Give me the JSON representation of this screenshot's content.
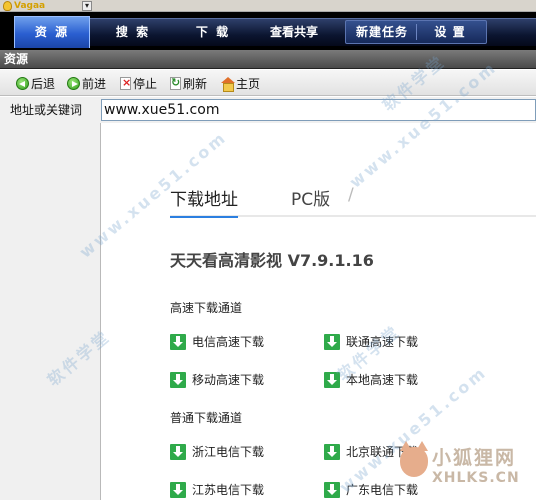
{
  "app": {
    "logo_text": "Vagaa",
    "title_control": "▾"
  },
  "nav": {
    "tabs": [
      {
        "label": "资 源",
        "active": true
      },
      {
        "label": "搜 索"
      },
      {
        "label": "下 载"
      },
      {
        "label": "查看共享"
      }
    ],
    "group": [
      "新建任务",
      "设 置"
    ]
  },
  "section": {
    "title": "资源"
  },
  "toolbar": {
    "back": "后退",
    "forward": "前进",
    "stop": "停止",
    "refresh": "刷新",
    "home": "主页"
  },
  "address": {
    "label": "地址或关键词",
    "value": "www.xue51.com"
  },
  "page": {
    "tabs": [
      "下载地址",
      "PC版"
    ],
    "tab_separator": "/",
    "software_title": "天天看高清影视 V7.9.1.16",
    "groups": [
      {
        "title": "高速下载通道",
        "links": [
          "电信高速下载",
          "联通高速下载",
          "移动高速下载",
          "本地高速下载"
        ]
      },
      {
        "title": "普通下载通道",
        "links": [
          "浙江电信下载",
          "北京联通下载",
          "江苏电信下载",
          "广东电信下载"
        ]
      }
    ]
  },
  "watermarks": {
    "site": "www.xue51.com",
    "cn": "软件学堂",
    "fox_cn": "小狐狸网",
    "fox_en": "XHLKS.CN"
  },
  "colors": {
    "accent_tab": "#2b7fe0",
    "download_icon": "#2faa4a",
    "nav_active": "#2a5ed0"
  }
}
